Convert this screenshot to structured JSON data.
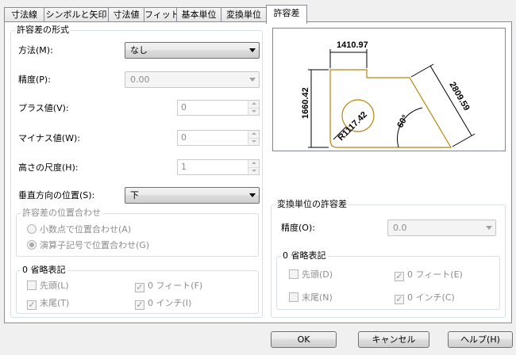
{
  "tabs": [
    "寸法線",
    "シンボルと矢印",
    "寸法値",
    "フィット",
    "基本単位",
    "変換単位",
    "許容差"
  ],
  "tolerance_format": {
    "title": "許容差の形式",
    "method": {
      "label": "方法(M):",
      "value": "なし"
    },
    "precision": {
      "label": "精度(P):",
      "value": "0.00"
    },
    "upper": {
      "label": "プラス値(V):",
      "value": "0"
    },
    "lower": {
      "label": "マイナス値(W):",
      "value": "0"
    },
    "height_scale": {
      "label": "高さの尺度(H):",
      "value": "1"
    },
    "vertical_position": {
      "label": "垂直方向の位置(S):",
      "value": "下"
    },
    "alignment": {
      "title": "許容差の位置合わせ",
      "option_decimal": "小数点で位置合わせ(A)",
      "option_operator": "演算子記号で位置合わせ(G)",
      "selected": "operator"
    },
    "zero_suppression": {
      "title": "0 省略表記",
      "leading": {
        "label": "先頭(L)",
        "checked": false
      },
      "trailing": {
        "label": "末尾(T)",
        "checked": true
      },
      "feet": {
        "label": "0 フィート(F)",
        "checked": true
      },
      "inches": {
        "label": "0 インチ(I)",
        "checked": true
      }
    }
  },
  "preview": {
    "dim_top": "1410.97",
    "dim_left": "1660.42",
    "dim_diag": "2809.59",
    "dim_radius": "R1117.42",
    "dim_angle": "60°"
  },
  "alt_unit_tolerance": {
    "title": "変換単位の許容差",
    "precision": {
      "label": "精度(O):",
      "value": "0.0"
    },
    "zero_suppression": {
      "title": "0 省略表記",
      "leading": {
        "label": "先頭(D)",
        "checked": false
      },
      "trailing": {
        "label": "末尾(N)",
        "checked": false
      },
      "feet": {
        "label": "0 フィート(E)",
        "checked": true
      },
      "inches": {
        "label": "0 インチ(C)",
        "checked": true
      }
    }
  },
  "buttons": {
    "ok": "OK",
    "cancel": "キャンセル",
    "help": "ヘルプ(H)"
  },
  "colors": {
    "geometry": "#b8860b",
    "dimension": "#000000"
  }
}
